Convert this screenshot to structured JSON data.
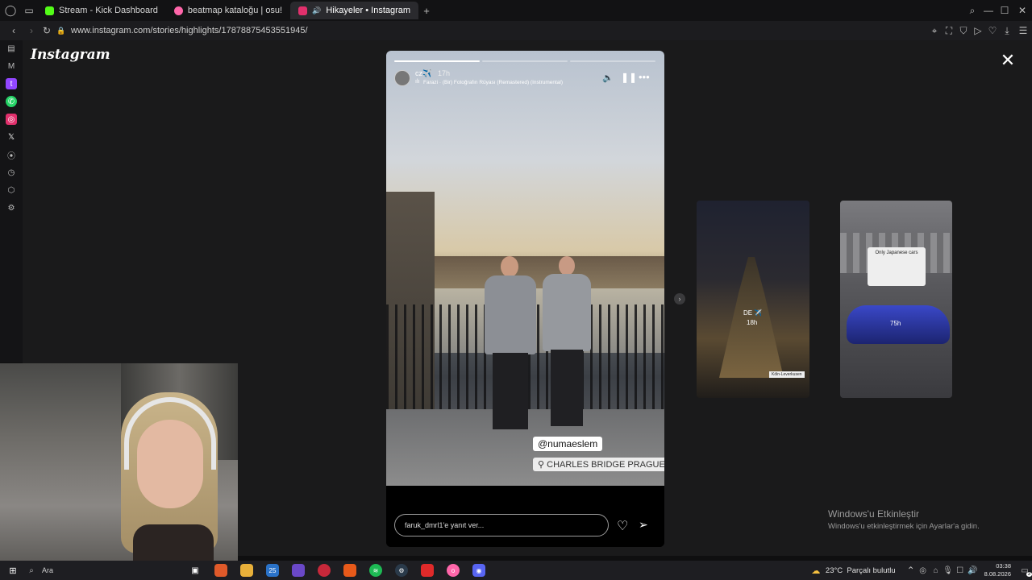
{
  "browser": {
    "tabs": [
      {
        "label": "Stream - Kick Dashboard",
        "color": "#53fc18"
      },
      {
        "label": "beatmap kataloğu | osu!",
        "color": "#ff66aa"
      },
      {
        "label": "Hikayeler • Instagram",
        "color": "#e1306c"
      }
    ],
    "new_tab_symbol": "+",
    "url": "www.instagram.com/stories/highlights/17878875453551945/"
  },
  "instagram": {
    "logo": "Instagram",
    "story": {
      "username": "cz✈️",
      "time": "17h",
      "music": "Farazi · (Bir) Fotoğrafın Rüyası (Remastered) (Instrumental)",
      "mention": "@numaeslem",
      "location": "CHARLES BRIDGE PRAGUE",
      "reply_placeholder": "faruk_dmrl1'e yanıt ver..."
    },
    "previews": [
      {
        "label": "DE ✈️",
        "time": "18h",
        "sticker": "Köln-Leverkusen"
      },
      {
        "label": "Only Japanese cars",
        "time": "75h"
      }
    ]
  },
  "watermark": {
    "title": "Windows'u Etkinleştir",
    "subtitle": "Windows'u etkinleştirmek için Ayarlar'a gidin."
  },
  "taskbar": {
    "search": "Ara",
    "weather": "23°C  Parçalı bulutlu",
    "time": "03:38",
    "date": "8.08.2026",
    "notif_count": "3",
    "badge_count": "25"
  }
}
